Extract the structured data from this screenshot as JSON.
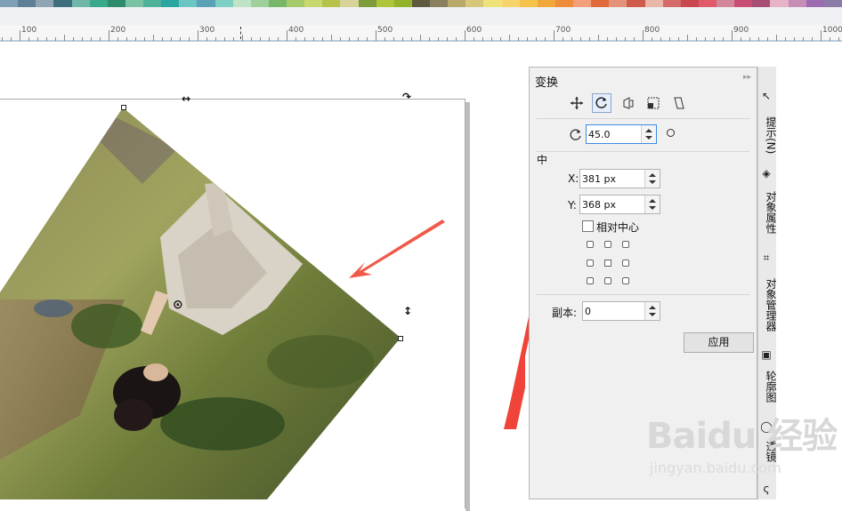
{
  "palette": [
    "#7ea1b5",
    "#5e7f96",
    "#8fa5b3",
    "#3f6f7c",
    "#6fb7a8",
    "#38a98a",
    "#2f8b6d",
    "#79c3a4",
    "#4fb19a",
    "#2aa5a0",
    "#6ac5c5",
    "#5aa2b8",
    "#7fd0c4",
    "#bfe3c5",
    "#9fcf9b",
    "#78b769",
    "#a6c96a",
    "#c6d86e",
    "#b6c24a",
    "#d7d39a",
    "#7c9b3b",
    "#aec43a",
    "#93b32b",
    "#5f5a3f",
    "#8a8060",
    "#b8a86a",
    "#d6c77a",
    "#f0e27a",
    "#f7d46a",
    "#f5c24a",
    "#f0a83a",
    "#ef8c3a",
    "#f2a07a",
    "#e06a3a",
    "#e4927a",
    "#cf5b4a",
    "#e9b6a8",
    "#d46a6a",
    "#c9474e",
    "#e05a6a",
    "#d3869a",
    "#c94e74",
    "#a84e76",
    "#e6b3c7",
    "#c68db7",
    "#9d6bb0",
    "#8b7ba8"
  ],
  "ruler": {
    "labels": [
      "100",
      "200",
      "300",
      "400",
      "500",
      "600",
      "700",
      "800",
      "900",
      "1000"
    ]
  },
  "docker": {
    "title": "变换",
    "collapse_icon": "▸▸",
    "tools": [
      "position-icon",
      "rotate-icon",
      "scale-mirror-icon",
      "size-icon",
      "skew-icon"
    ],
    "rotate_angle": "45.0",
    "center_label": "中",
    "x_label": "X:",
    "x_value": "381 px",
    "y_label": "Y:",
    "y_value": "368 px",
    "relative_center_label": "相对中心",
    "copies_label": "副本:",
    "copies_value": "0",
    "apply_label": "应用"
  },
  "side_tabs": {
    "hints": "提示(N)",
    "object_properties": "对象属性",
    "object_manager": "对象管理器",
    "contour": "轮廓图",
    "lens": "透镜"
  },
  "watermark": {
    "brand": "Baidu 经验",
    "url": "jingyan.baidu.com"
  }
}
